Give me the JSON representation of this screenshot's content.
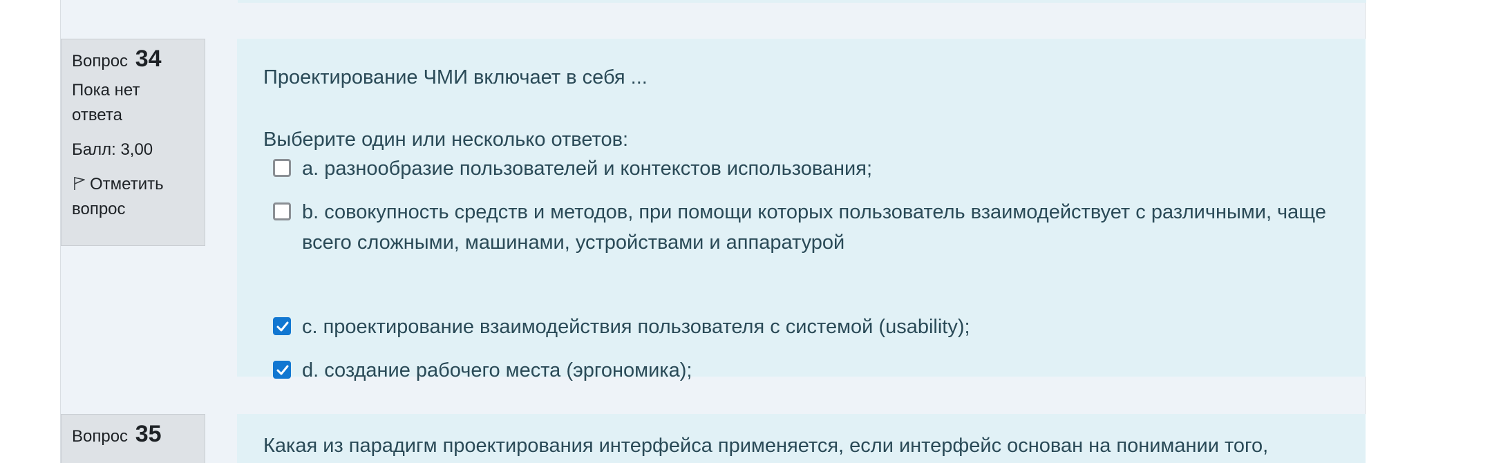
{
  "questions": [
    {
      "label": "Вопрос",
      "number": "34",
      "state": "Пока нет ответа",
      "grade": "Балл: 3,00",
      "flag_label": "Отметить вопрос",
      "text": "Проектирование ЧМИ включает в себя ...",
      "prompt": "Выберите один или несколько ответов:",
      "answers": [
        {
          "letter": "a.",
          "text": "разнообразие пользователей и контекстов использования;",
          "checked": false
        },
        {
          "letter": "b.",
          "text": "совокупность средств и методов, при помощи которых пользователь взаимодействует с различными, чаще всего сложными, машинами, устройствами и аппаратурой",
          "checked": false
        },
        {
          "letter": "c.",
          "text": "проектирование взаимодействия пользователя с системой (usability);",
          "checked": true
        },
        {
          "letter": "d.",
          "text": "создание рабочего места (эргономика);",
          "checked": true
        }
      ]
    },
    {
      "label": "Вопрос",
      "number": "35",
      "text": "Какая из парадигм проектирования интерфейса применяется, если интерфейс основан на понимании того,"
    }
  ],
  "colors": {
    "page_bg": "#eef3f8",
    "info_bg": "#dee2e6",
    "formulation_bg": "#e1f1f6",
    "checkbox_checked": "#1177d1",
    "text": "#2a4a57"
  },
  "icons": {
    "flag": "flag-icon",
    "check": "check-icon"
  }
}
